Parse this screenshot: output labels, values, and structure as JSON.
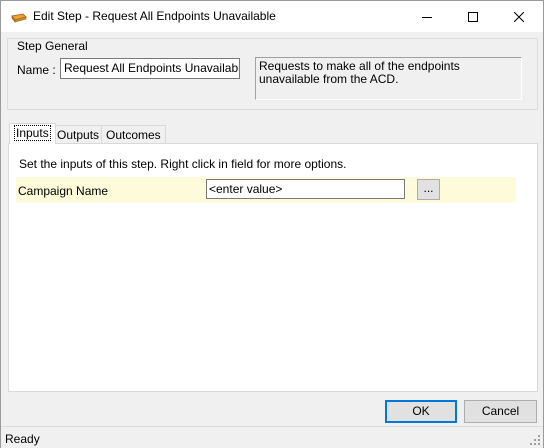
{
  "window": {
    "title": "Edit Step - Request All Endpoints Unavailable",
    "app_icon": "step-icon",
    "controls": {
      "minimize": "minimize-icon",
      "maximize": "maximize-icon",
      "close": "close-icon"
    }
  },
  "step_general": {
    "legend": "Step General",
    "name_label": "Name :",
    "name_value": "Request All Endpoints Unavailable",
    "description": "Requests to make all of the endpoints unavailable from the ACD."
  },
  "tabs": [
    {
      "label": "Inputs",
      "active": true
    },
    {
      "label": "Outputs",
      "active": false
    },
    {
      "label": "Outcomes",
      "active": false
    }
  ],
  "inputs_panel": {
    "instructions": "Set the inputs of this step.  Right click in field for more options.",
    "parameters": [
      {
        "label": "Campaign Name",
        "value": "<enter value>",
        "browse_label": "..."
      }
    ],
    "row_highlight_color": "#fdfbd9"
  },
  "buttons": {
    "ok": "OK",
    "cancel": "Cancel"
  },
  "status": {
    "text": "Ready"
  }
}
